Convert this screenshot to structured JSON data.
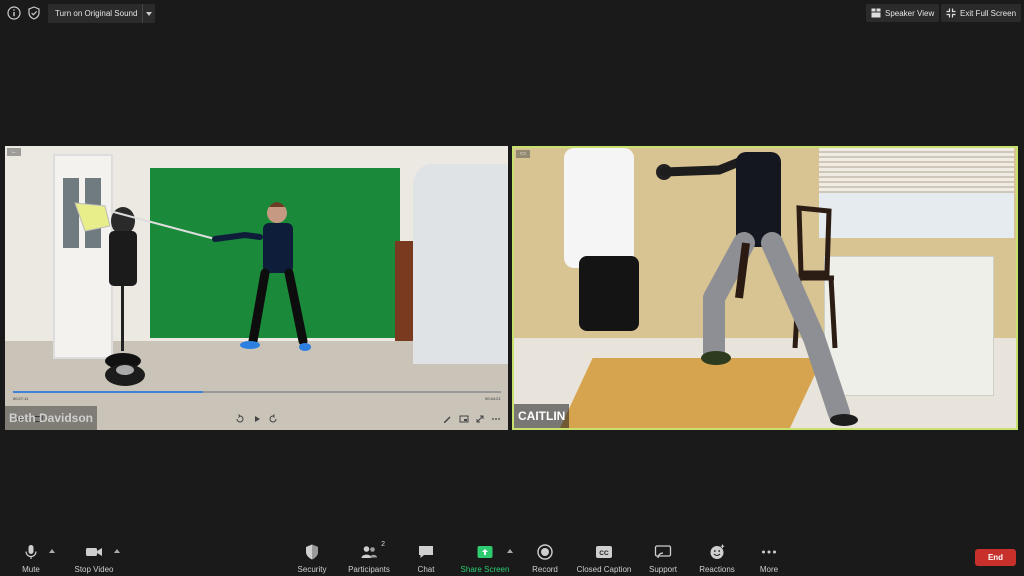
{
  "top_bar": {
    "info_icon": "info-icon",
    "security_icon": "shield-check-icon",
    "original_sound_label": "Turn on Original Sound",
    "speaker_view_label": "Speaker View",
    "exit_full_screen_label": "Exit Full Screen"
  },
  "participants": [
    {
      "name": "Beth Davidson",
      "active_speaker": false
    },
    {
      "name": "CAITLIN",
      "active_speaker": true
    }
  ],
  "shared_video": {
    "progress_fraction": 0.39,
    "time_elapsed": "00:27:11",
    "time_remaining": "00:44:21"
  },
  "toolbar": {
    "mute": "Mute",
    "stop_video": "Stop Video",
    "security": "Security",
    "participants": "Participants",
    "participants_count": "2",
    "chat": "Chat",
    "share_screen": "Share Screen",
    "record": "Record",
    "closed_caption": "Closed Caption",
    "support": "Support",
    "reactions": "Reactions",
    "more": "More",
    "end": "End"
  },
  "colors": {
    "background": "#1a1a1a",
    "active_speaker_border": "#c7e06e",
    "share_green": "#2ecc71",
    "end_red": "#c8302c",
    "progress_blue": "#3f82d8"
  }
}
